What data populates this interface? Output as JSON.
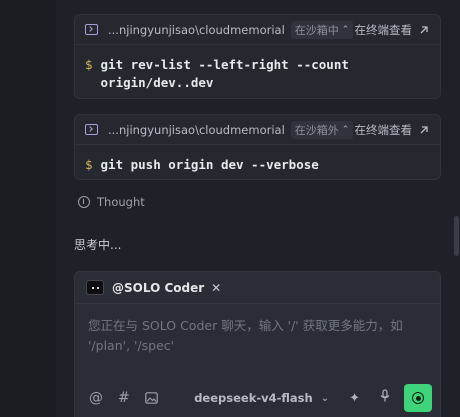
{
  "terminals": [
    {
      "path": "...njingyunjisao\\cloudmemorial",
      "sandbox": "在沙箱中",
      "open_label": "在终端查看",
      "prompt": "$",
      "command": "git rev-list --left-right --count\norigin/dev..dev"
    },
    {
      "path": "...njingyunjisao\\cloudmemorial",
      "sandbox": "在沙箱外",
      "open_label": "在终端查看",
      "prompt": "$",
      "command": "git push origin dev --verbose"
    }
  ],
  "thought": {
    "label": "Thought",
    "icon": "info-circle-icon"
  },
  "status": {
    "thinking": "思考中..."
  },
  "chat": {
    "agent": "@SOLO Coder",
    "placeholder": "您正在与 SOLO Coder 聊天，输入 '/' 获取更多能力，如 '/plan', '/spec'",
    "model": "deepseek-v4-flash",
    "send_color": "#3ed47a"
  }
}
